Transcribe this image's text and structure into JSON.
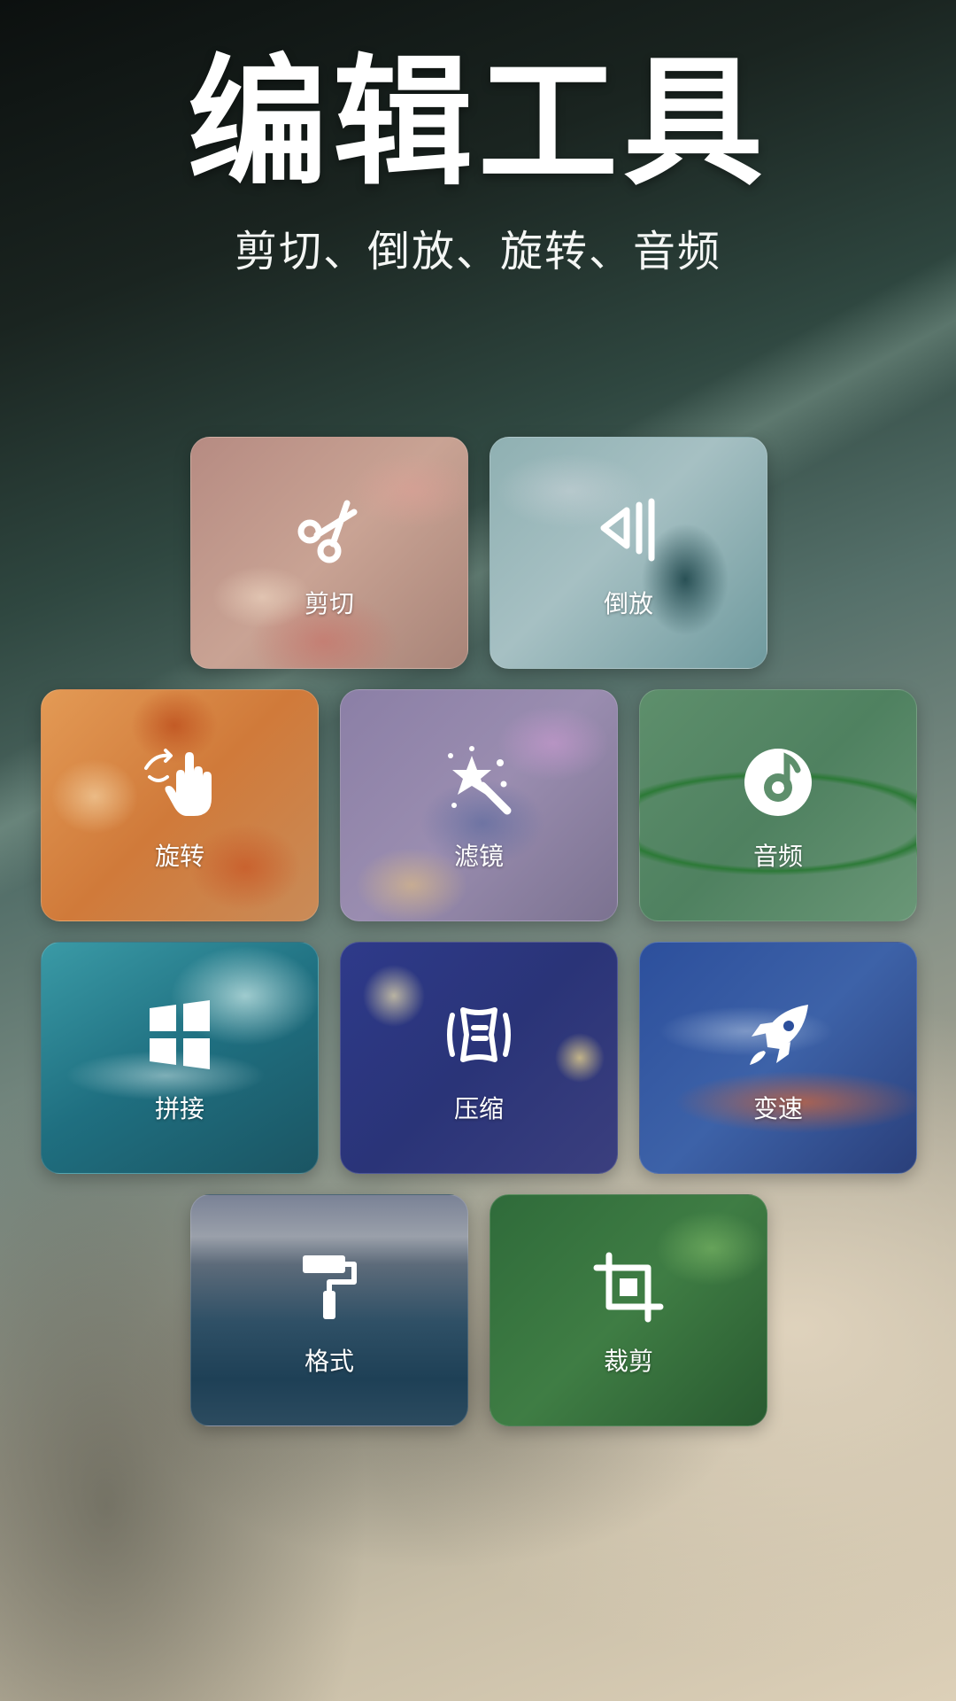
{
  "header": {
    "title": "编辑工具",
    "subtitle": "剪切、倒放、旋转、音频"
  },
  "tools": [
    {
      "label": "剪切",
      "icon": "scissors-icon"
    },
    {
      "label": "倒放",
      "icon": "reverse-icon"
    },
    {
      "label": "旋转",
      "icon": "rotate-hand-icon"
    },
    {
      "label": "滤镜",
      "icon": "magic-wand-icon"
    },
    {
      "label": "音频",
      "icon": "music-note-icon"
    },
    {
      "label": "拼接",
      "icon": "grid-icon"
    },
    {
      "label": "压缩",
      "icon": "compress-icon"
    },
    {
      "label": "变速",
      "icon": "rocket-icon"
    },
    {
      "label": "格式",
      "icon": "paint-roller-icon"
    },
    {
      "label": "裁剪",
      "icon": "crop-icon"
    }
  ]
}
